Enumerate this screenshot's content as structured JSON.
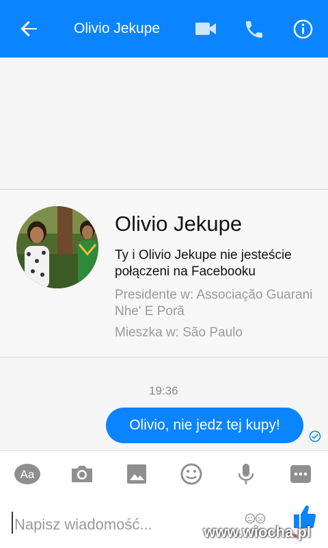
{
  "header": {
    "back_icon": "arrow-left-icon",
    "title": "Olivio Jekupe",
    "video_icon": "video-camera-icon",
    "phone_icon": "phone-icon",
    "info_icon": "info-icon",
    "color": "#0a84ff"
  },
  "profile_card": {
    "name": "Olivio Jekupe",
    "connection_text": "Ty i Olivio Jekupe nie jesteście połączeni na Facebooku",
    "work_text": "Presidente w: Associação Guarani Nhe' E Porã",
    "lives_text": "Mieszka w: São Paulo"
  },
  "conversation": {
    "timestamp": "19:36",
    "messages": [
      {
        "from": "me",
        "text": "Olivio, nie jedz tej kupy!",
        "status_icon": "seen-check-icon"
      }
    ]
  },
  "toolbar": {
    "items": [
      "text-format-aa-icon",
      "camera-icon",
      "image-icon",
      "emoji-icon",
      "microphone-icon",
      "more-icon"
    ],
    "aa_label": "Aa"
  },
  "composer": {
    "placeholder": "Napisz wiadomość...",
    "emoji_icon": "sticker-emoji-icon",
    "like_icon": "thumbs-up-icon"
  },
  "watermark": {
    "text_left": "www.wiocha",
    "dot": ".",
    "text_right": "pl"
  }
}
